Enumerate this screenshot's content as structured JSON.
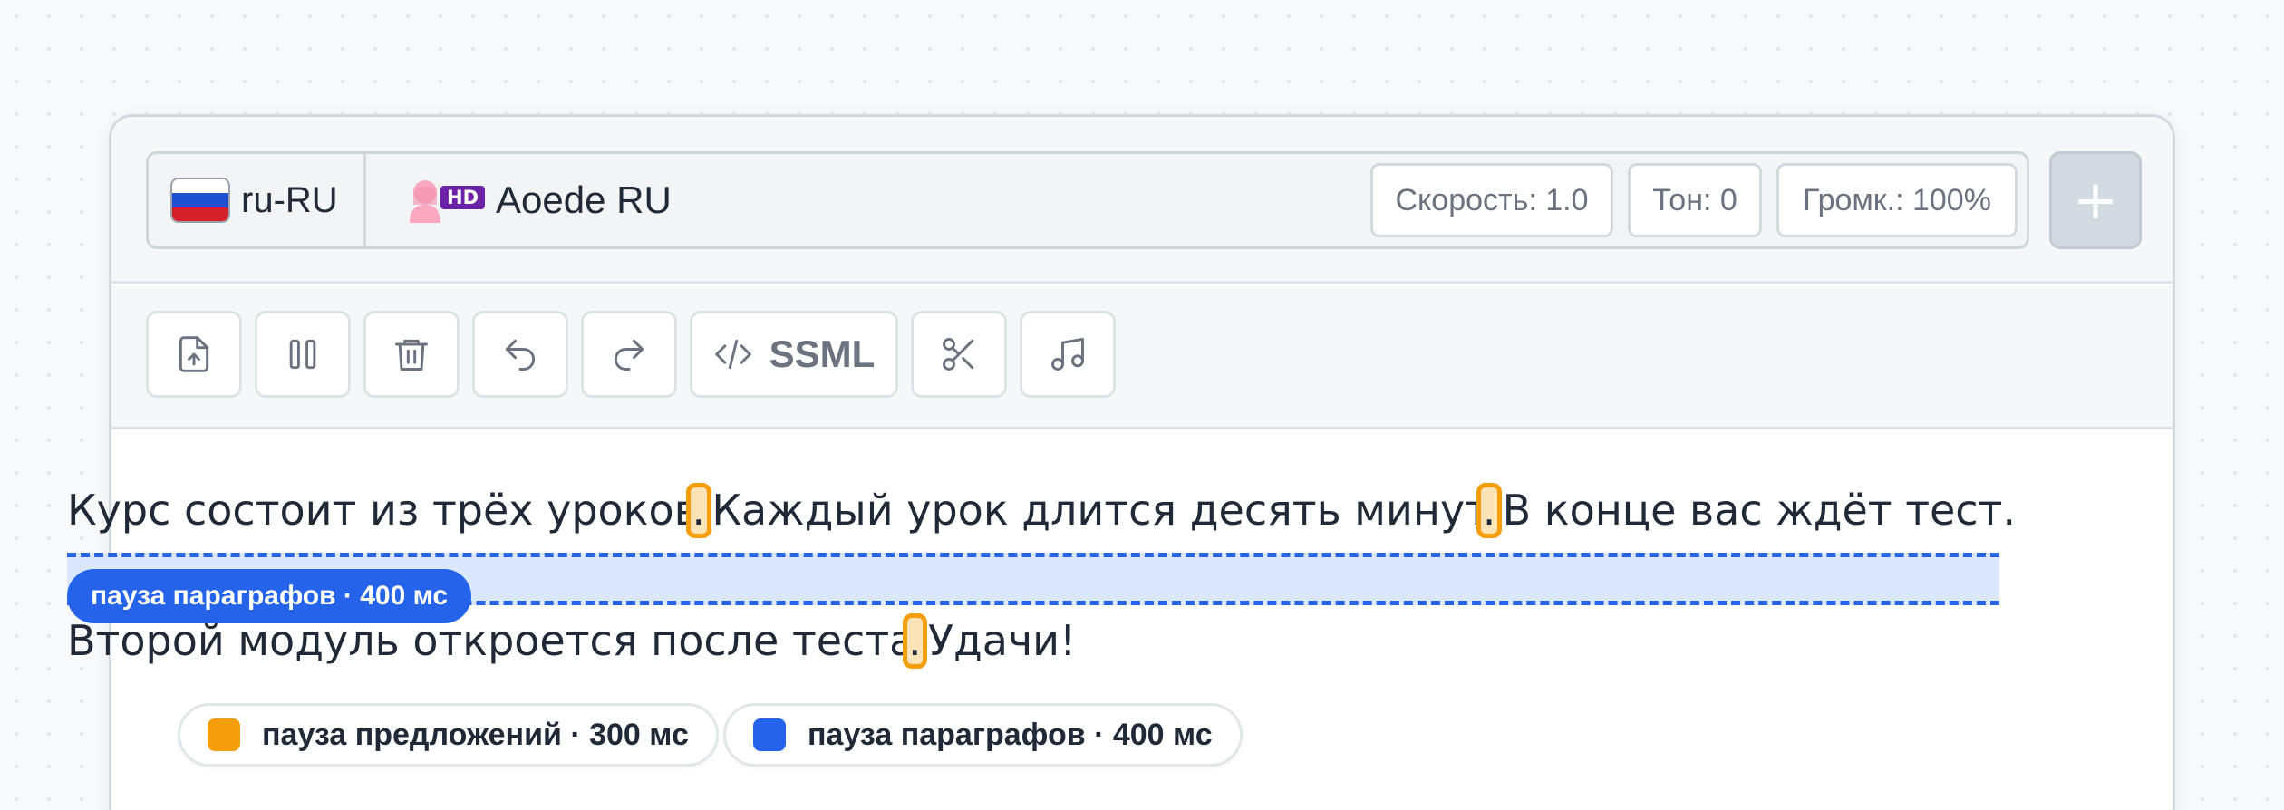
{
  "voice_bar": {
    "language": "ru-RU",
    "voice_badge": "HD",
    "voice_name": "Aoede RU",
    "speed": "Скорость: 1.0",
    "pitch": "Тон: 0",
    "volume": "Громк.: 100%",
    "add_label": "+"
  },
  "toolbar": {
    "ssml_label": "SSML",
    "buttons": [
      "upload-icon",
      "pause-icon",
      "trash-icon",
      "undo-icon",
      "redo-icon",
      "code-icon",
      "scissors-icon",
      "music-note-icon"
    ]
  },
  "editor": {
    "para1": {
      "s1": "Курс состоит из трёх уроков",
      "m1": ".",
      "s2": " Каждый урок длится десять минут",
      "m2": ".",
      "s3": " В конце вас ждёт тест."
    },
    "paragraph_break_label": "пауза параграфов · 400 мс",
    "para2": {
      "s1": "Второй модуль откроется после теста",
      "m1": ".",
      "s2": " Удачи!"
    }
  },
  "legend": {
    "sentence_pause": "пауза предложений · 300 мс",
    "paragraph_pause": "пауза параграфов · 400 мс"
  },
  "colors": {
    "sentence_pause": "#f59e0b",
    "paragraph_pause": "#2563eb",
    "hd_badge": "#6b21a8"
  }
}
